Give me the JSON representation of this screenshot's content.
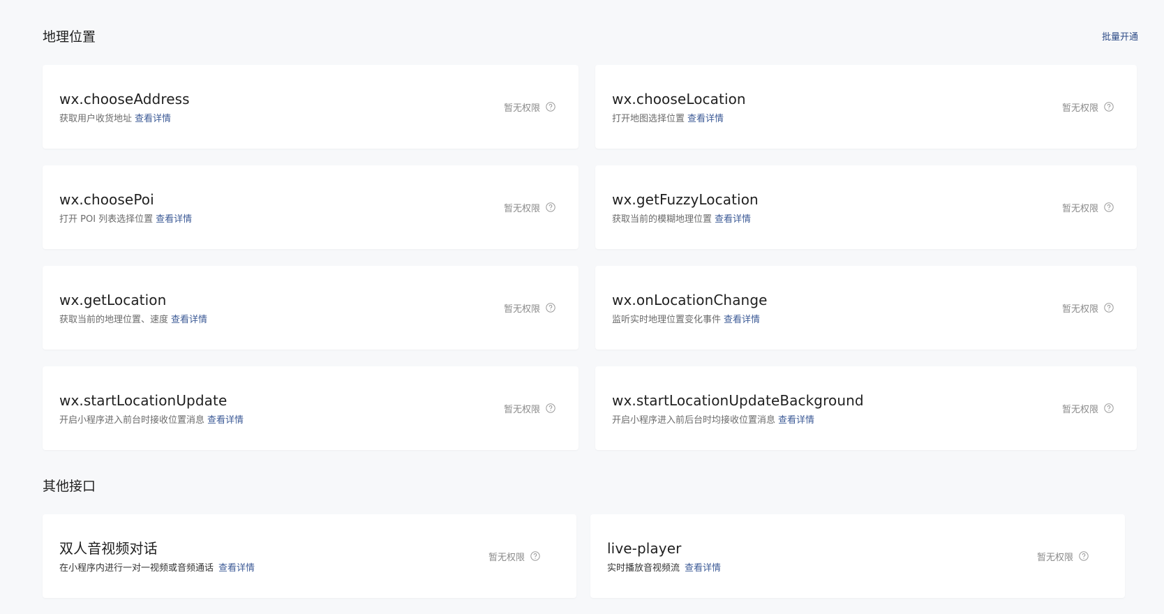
{
  "sections": [
    {
      "title": "地理位置",
      "batch_label": "批量开通",
      "cards": [
        {
          "title": "wx.chooseAddress",
          "desc": "获取用户收货地址",
          "link": "查看详情",
          "status": "暂无权限"
        },
        {
          "title": "wx.chooseLocation",
          "desc": "打开地图选择位置",
          "link": "查看详情",
          "status": "暂无权限"
        },
        {
          "title": "wx.choosePoi",
          "desc": "打开 POI 列表选择位置",
          "link": "查看详情",
          "status": "暂无权限"
        },
        {
          "title": "wx.getFuzzyLocation",
          "desc": "获取当前的模糊地理位置",
          "link": "查看详情",
          "status": "暂无权限"
        },
        {
          "title": "wx.getLocation",
          "desc": "获取当前的地理位置、速度",
          "link": "查看详情",
          "status": "暂无权限"
        },
        {
          "title": "wx.onLocationChange",
          "desc": "监听实时地理位置变化事件",
          "link": "查看详情",
          "status": "暂无权限"
        },
        {
          "title": "wx.startLocationUpdate",
          "desc": "开启小程序进入前台时接收位置消息",
          "link": "查看详情",
          "status": "暂无权限"
        },
        {
          "title": "wx.startLocationUpdateBackground",
          "desc": "开启小程序进入前后台时均接收位置消息",
          "link": "查看详情",
          "status": "暂无权限"
        }
      ]
    },
    {
      "title": "其他接口",
      "cards": [
        {
          "title": "双人音视频对话",
          "desc": "在小程序内进行一对一视频或音频通话",
          "link": "查看详情",
          "status": "暂无权限"
        },
        {
          "title": "live-player",
          "desc": "实时播放音视频流",
          "link": "查看详情",
          "status": "暂无权限"
        }
      ]
    }
  ]
}
